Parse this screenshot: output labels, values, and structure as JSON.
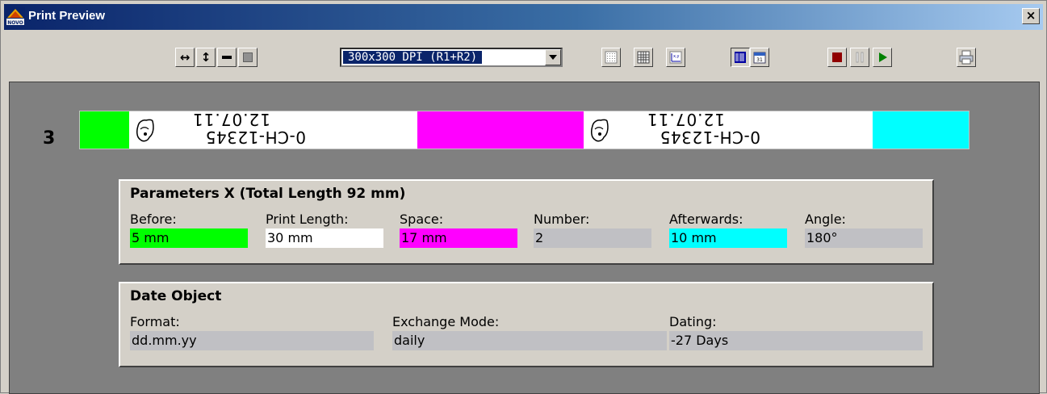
{
  "window": {
    "title": "Print Preview",
    "close_label": "×"
  },
  "toolbar": {
    "fit_width_icon": "↔",
    "fit_height_icon": "↕",
    "dpi_value": "300x300 DPI (R1+R2)"
  },
  "label": {
    "number": "3",
    "print_line1": "12.07.11",
    "print_line2": "0-CH-12345",
    "colors": {
      "before": "#00ff00",
      "space": "#ff00ff",
      "afterwards": "#00ffff"
    }
  },
  "params": {
    "title": "Parameters X  (Total Length 92 mm)",
    "before_label": "Before:",
    "before_value": "5 mm",
    "print_length_label": "Print Length:",
    "print_length_value": "30 mm",
    "space_label": "Space:",
    "space_value": "17 mm",
    "number_label": "Number:",
    "number_value": "2",
    "afterwards_label": "Afterwards:",
    "afterwards_value": "10 mm",
    "angle_label": "Angle:",
    "angle_value": "180°"
  },
  "date_object": {
    "title": "Date Object",
    "format_label": "Format:",
    "format_value": "dd.mm.yy",
    "exchange_label": "Exchange Mode:",
    "exchange_value": "daily",
    "dating_label": "Dating:",
    "dating_value": "-27 Days"
  }
}
